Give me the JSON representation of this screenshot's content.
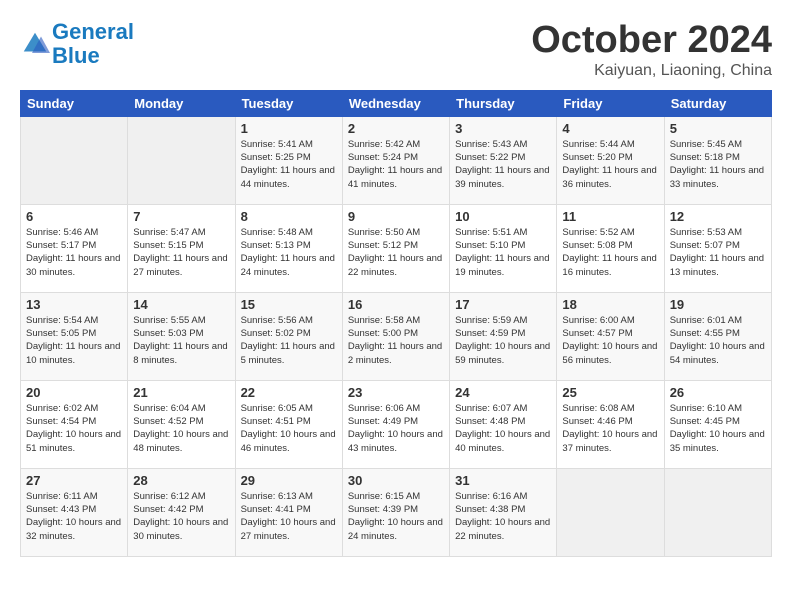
{
  "logo": {
    "line1": "General",
    "line2": "Blue"
  },
  "title": "October 2024",
  "subtitle": "Kaiyuan, Liaoning, China",
  "headers": [
    "Sunday",
    "Monday",
    "Tuesday",
    "Wednesday",
    "Thursday",
    "Friday",
    "Saturday"
  ],
  "weeks": [
    [
      {
        "day": "",
        "info": ""
      },
      {
        "day": "",
        "info": ""
      },
      {
        "day": "1",
        "info": "Sunrise: 5:41 AM\nSunset: 5:25 PM\nDaylight: 11 hours and 44 minutes."
      },
      {
        "day": "2",
        "info": "Sunrise: 5:42 AM\nSunset: 5:24 PM\nDaylight: 11 hours and 41 minutes."
      },
      {
        "day": "3",
        "info": "Sunrise: 5:43 AM\nSunset: 5:22 PM\nDaylight: 11 hours and 39 minutes."
      },
      {
        "day": "4",
        "info": "Sunrise: 5:44 AM\nSunset: 5:20 PM\nDaylight: 11 hours and 36 minutes."
      },
      {
        "day": "5",
        "info": "Sunrise: 5:45 AM\nSunset: 5:18 PM\nDaylight: 11 hours and 33 minutes."
      }
    ],
    [
      {
        "day": "6",
        "info": "Sunrise: 5:46 AM\nSunset: 5:17 PM\nDaylight: 11 hours and 30 minutes."
      },
      {
        "day": "7",
        "info": "Sunrise: 5:47 AM\nSunset: 5:15 PM\nDaylight: 11 hours and 27 minutes."
      },
      {
        "day": "8",
        "info": "Sunrise: 5:48 AM\nSunset: 5:13 PM\nDaylight: 11 hours and 24 minutes."
      },
      {
        "day": "9",
        "info": "Sunrise: 5:50 AM\nSunset: 5:12 PM\nDaylight: 11 hours and 22 minutes."
      },
      {
        "day": "10",
        "info": "Sunrise: 5:51 AM\nSunset: 5:10 PM\nDaylight: 11 hours and 19 minutes."
      },
      {
        "day": "11",
        "info": "Sunrise: 5:52 AM\nSunset: 5:08 PM\nDaylight: 11 hours and 16 minutes."
      },
      {
        "day": "12",
        "info": "Sunrise: 5:53 AM\nSunset: 5:07 PM\nDaylight: 11 hours and 13 minutes."
      }
    ],
    [
      {
        "day": "13",
        "info": "Sunrise: 5:54 AM\nSunset: 5:05 PM\nDaylight: 11 hours and 10 minutes."
      },
      {
        "day": "14",
        "info": "Sunrise: 5:55 AM\nSunset: 5:03 PM\nDaylight: 11 hours and 8 minutes."
      },
      {
        "day": "15",
        "info": "Sunrise: 5:56 AM\nSunset: 5:02 PM\nDaylight: 11 hours and 5 minutes."
      },
      {
        "day": "16",
        "info": "Sunrise: 5:58 AM\nSunset: 5:00 PM\nDaylight: 11 hours and 2 minutes."
      },
      {
        "day": "17",
        "info": "Sunrise: 5:59 AM\nSunset: 4:59 PM\nDaylight: 10 hours and 59 minutes."
      },
      {
        "day": "18",
        "info": "Sunrise: 6:00 AM\nSunset: 4:57 PM\nDaylight: 10 hours and 56 minutes."
      },
      {
        "day": "19",
        "info": "Sunrise: 6:01 AM\nSunset: 4:55 PM\nDaylight: 10 hours and 54 minutes."
      }
    ],
    [
      {
        "day": "20",
        "info": "Sunrise: 6:02 AM\nSunset: 4:54 PM\nDaylight: 10 hours and 51 minutes."
      },
      {
        "day": "21",
        "info": "Sunrise: 6:04 AM\nSunset: 4:52 PM\nDaylight: 10 hours and 48 minutes."
      },
      {
        "day": "22",
        "info": "Sunrise: 6:05 AM\nSunset: 4:51 PM\nDaylight: 10 hours and 46 minutes."
      },
      {
        "day": "23",
        "info": "Sunrise: 6:06 AM\nSunset: 4:49 PM\nDaylight: 10 hours and 43 minutes."
      },
      {
        "day": "24",
        "info": "Sunrise: 6:07 AM\nSunset: 4:48 PM\nDaylight: 10 hours and 40 minutes."
      },
      {
        "day": "25",
        "info": "Sunrise: 6:08 AM\nSunset: 4:46 PM\nDaylight: 10 hours and 37 minutes."
      },
      {
        "day": "26",
        "info": "Sunrise: 6:10 AM\nSunset: 4:45 PM\nDaylight: 10 hours and 35 minutes."
      }
    ],
    [
      {
        "day": "27",
        "info": "Sunrise: 6:11 AM\nSunset: 4:43 PM\nDaylight: 10 hours and 32 minutes."
      },
      {
        "day": "28",
        "info": "Sunrise: 6:12 AM\nSunset: 4:42 PM\nDaylight: 10 hours and 30 minutes."
      },
      {
        "day": "29",
        "info": "Sunrise: 6:13 AM\nSunset: 4:41 PM\nDaylight: 10 hours and 27 minutes."
      },
      {
        "day": "30",
        "info": "Sunrise: 6:15 AM\nSunset: 4:39 PM\nDaylight: 10 hours and 24 minutes."
      },
      {
        "day": "31",
        "info": "Sunrise: 6:16 AM\nSunset: 4:38 PM\nDaylight: 10 hours and 22 minutes."
      },
      {
        "day": "",
        "info": ""
      },
      {
        "day": "",
        "info": ""
      }
    ]
  ]
}
